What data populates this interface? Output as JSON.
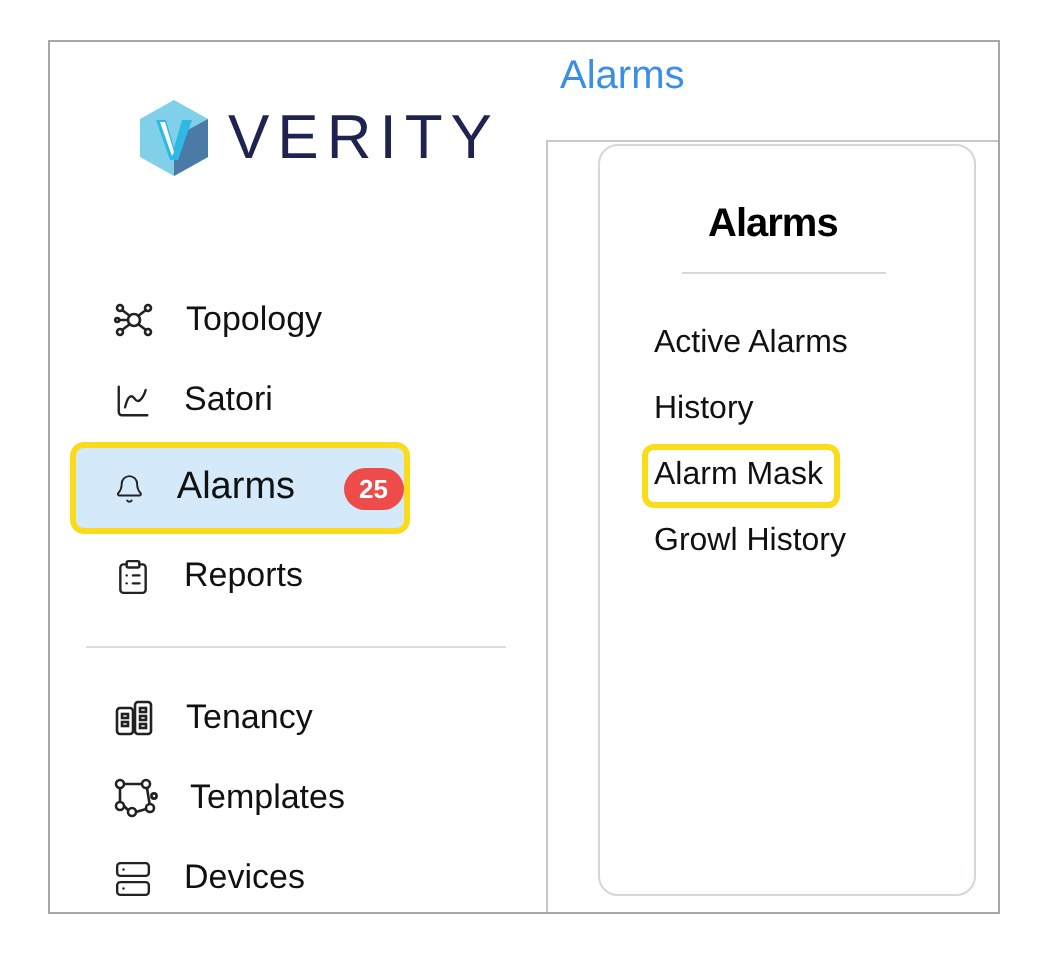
{
  "logo": {
    "text": "VERITY"
  },
  "sidebar": {
    "groups": [
      {
        "items": [
          {
            "label": "Topology",
            "selected": false,
            "highlighted": false
          },
          {
            "label": "Satori",
            "selected": false,
            "highlighted": false
          },
          {
            "label": "Alarms",
            "selected": true,
            "highlighted": true,
            "badge": "25"
          },
          {
            "label": "Reports",
            "selected": false,
            "highlighted": false
          }
        ]
      },
      {
        "items": [
          {
            "label": "Tenancy",
            "selected": false,
            "highlighted": false
          },
          {
            "label": "Templates",
            "selected": false,
            "highlighted": false
          },
          {
            "label": "Devices",
            "selected": false,
            "highlighted": false
          }
        ]
      }
    ]
  },
  "page_title": "Alarms",
  "submenu": {
    "title": "Alarms",
    "items": [
      {
        "label": "Active Alarms",
        "highlighted": false
      },
      {
        "label": "History",
        "highlighted": false
      },
      {
        "label": "Alarm Mask",
        "highlighted": true
      },
      {
        "label": "Growl History",
        "highlighted": false
      }
    ]
  }
}
